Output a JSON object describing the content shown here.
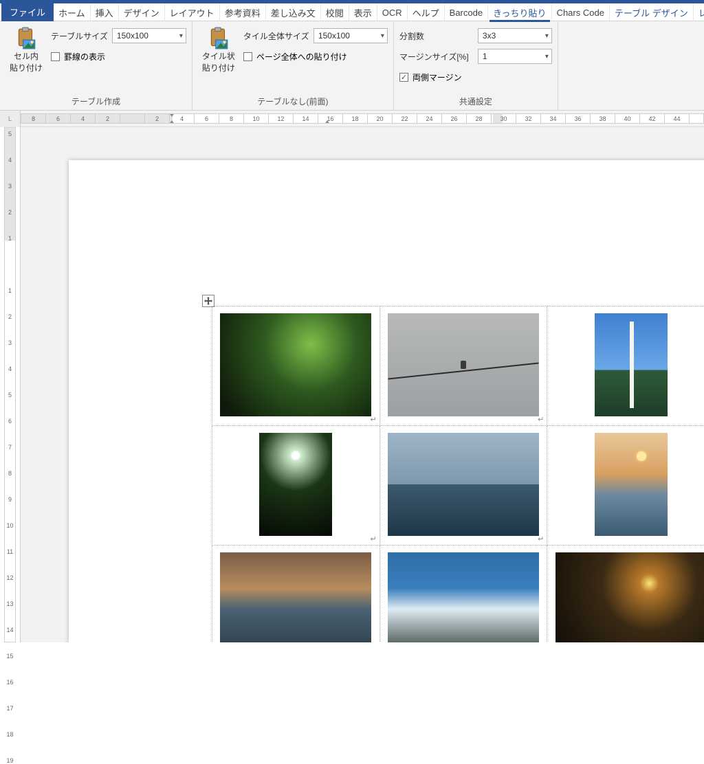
{
  "tabs": {
    "file": "ファイル",
    "home": "ホーム",
    "insert": "挿入",
    "design": "デザイン",
    "layout": "レイアウト",
    "references": "参考資料",
    "mailings": "差し込み文",
    "review": "校閲",
    "view": "表示",
    "ocr": "OCR",
    "help": "ヘルプ",
    "barcode": "Barcode",
    "kicchiri": "きっちり貼り",
    "chars": "Chars Code",
    "tableDesign": "テーブル デザイン",
    "layoutCtx": "レイ"
  },
  "ribbon": {
    "group1": {
      "title": "テーブル作成",
      "bigBtn": {
        "line1": "セル内",
        "line2": "貼り付け"
      },
      "tableSizeLabel": "テーブルサイズ",
      "tableSizeValue": "150x100",
      "showGridlines": "罫線の表示"
    },
    "group2": {
      "title": "テーブルなし(前面)",
      "bigBtn": {
        "line1": "タイル状",
        "line2": "貼り付け"
      },
      "tileSizeLabel": "タイル全体サイズ",
      "tileSizeValue": "150x100",
      "pasteFullPage": "ページ全体への貼り付け"
    },
    "group3": {
      "title": "共通設定",
      "splitLabel": "分割数",
      "splitValue": "3x3",
      "marginLabel": "マージンサイズ[%]",
      "marginValue": "1",
      "bothMargins": "両側マージン"
    }
  },
  "ruler": {
    "cornerL": "L",
    "h": [
      "8",
      "6",
      "4",
      "2",
      "",
      "2",
      "4",
      "6",
      "8",
      "10",
      "12",
      "14",
      "16",
      "18",
      "20",
      "22",
      "24",
      "26",
      "28",
      "30",
      "32",
      "34",
      "36",
      "38",
      "40",
      "42",
      "44"
    ],
    "v": [
      "5",
      "4",
      "3",
      "2",
      "1",
      "",
      "1",
      "2",
      "3",
      "4",
      "5",
      "6",
      "7",
      "8",
      "9",
      "10",
      "11",
      "12",
      "13",
      "14",
      "15",
      "16",
      "17",
      "18",
      "19"
    ]
  },
  "marks": {
    "para": "↵",
    "cell": "↵"
  }
}
